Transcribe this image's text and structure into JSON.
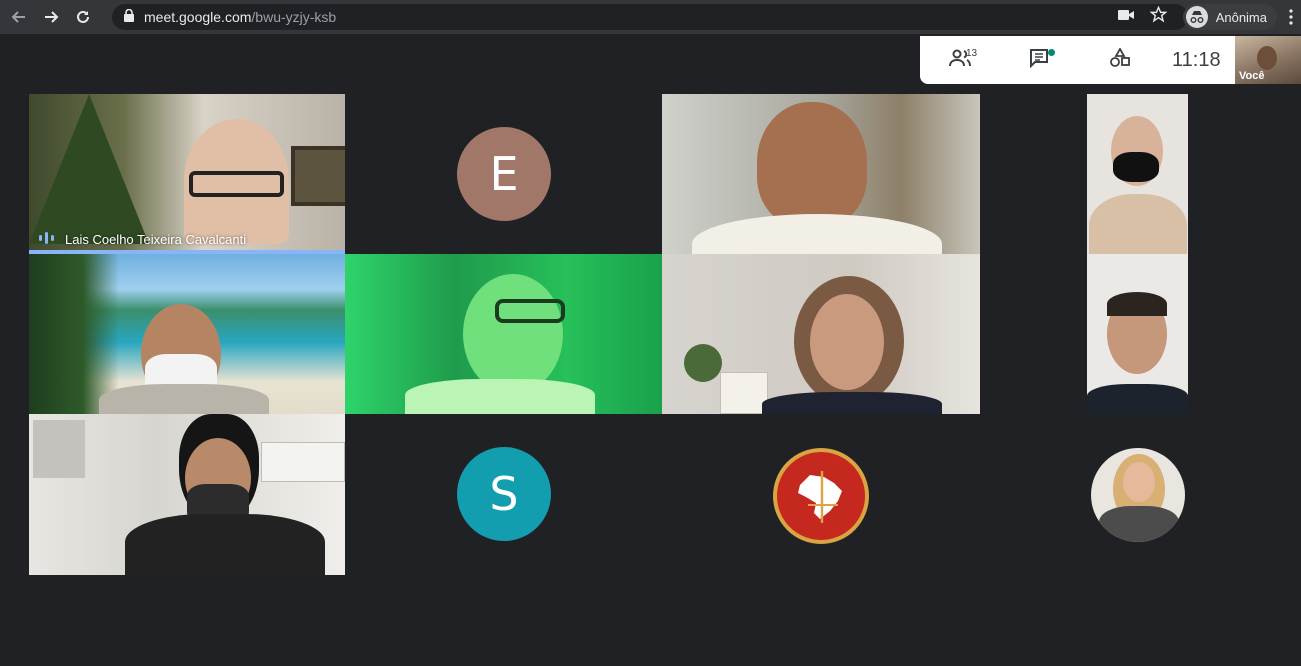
{
  "browser": {
    "url_host": "meet.google.com",
    "url_path": "/bwu-yzjy-ksb",
    "profile_label": "Anônima"
  },
  "meeting_bar": {
    "participants_count": "13",
    "time": "11:18",
    "self_label": "Você"
  },
  "tiles": {
    "speaker_name": "Lais Coelho Teixeira Cavalcanti",
    "avatar_e_letter": "E",
    "avatar_e_color": "#a1776a",
    "avatar_s_letter": "S",
    "avatar_s_color": "#129eaf"
  },
  "colors": {
    "background": "#202124",
    "speaking": "#8ab4f8"
  }
}
